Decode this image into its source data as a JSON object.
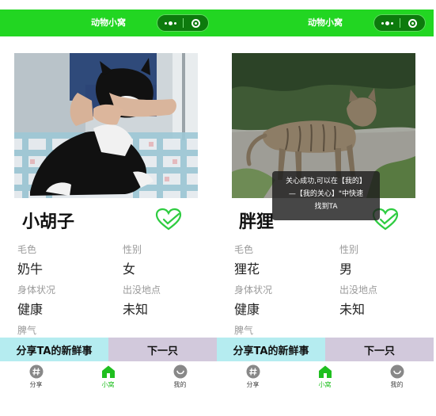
{
  "app": {
    "title": "动物小窝",
    "accent_color": "#22d622"
  },
  "screens": [
    {
      "animal": {
        "name": "小胡子",
        "fields": [
          {
            "label": "毛色",
            "value": "奶牛"
          },
          {
            "label": "性别",
            "value": "女"
          },
          {
            "label": "身体状况",
            "value": "健康"
          },
          {
            "label": "出没地点",
            "value": "未知"
          },
          {
            "label": "脾气",
            "value": ""
          }
        ],
        "photo_icon": "tuxedo-cat-photo",
        "favorited": false
      },
      "buttons": {
        "share": "分享TA的新鲜事",
        "next": "下一只"
      },
      "tabs": [
        {
          "label": "分享",
          "icon": "hash-icon"
        },
        {
          "label": "小窝",
          "icon": "home-icon",
          "active": true
        },
        {
          "label": "我的",
          "icon": "profile-icon"
        }
      ]
    },
    {
      "animal": {
        "name": "胖狸",
        "fields": [
          {
            "label": "毛色",
            "value": "狸花"
          },
          {
            "label": "性别",
            "value": "男"
          },
          {
            "label": "身体状况",
            "value": "健康"
          },
          {
            "label": "出没地点",
            "value": "未知"
          },
          {
            "label": "脾气",
            "value": ""
          }
        ],
        "photo_icon": "tabby-cat-photo",
        "favorited": true
      },
      "toast": {
        "line1": "关心成功,可以在【我的】",
        "line2": "—【我的关心】\"中快速",
        "line3": "找到TA"
      },
      "buttons": {
        "share": "分享TA的新鲜事",
        "next": "下一只"
      },
      "tabs": [
        {
          "label": "分享",
          "icon": "hash-icon"
        },
        {
          "label": "小窝",
          "icon": "home-icon",
          "active": true
        },
        {
          "label": "我的",
          "icon": "profile-icon"
        }
      ]
    }
  ]
}
